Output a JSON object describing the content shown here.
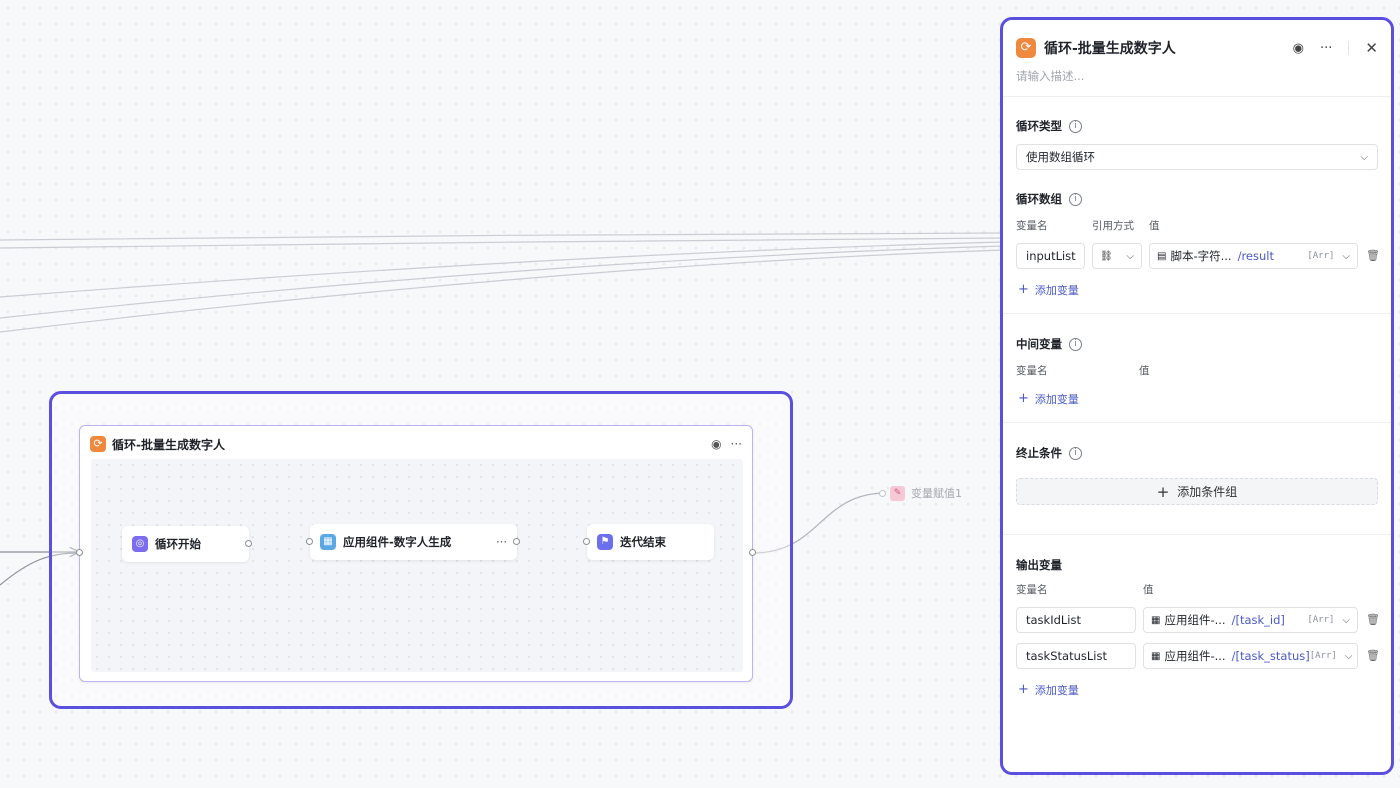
{
  "canvas": {
    "loop_node": {
      "title": "循环-批量生成数字人",
      "icon": "loop-icon",
      "more_label": "···",
      "children": {
        "start": {
          "label": "循环开始",
          "icon": "loop-start-icon"
        },
        "component": {
          "label": "应用组件-数字人生成",
          "icon": "component-icon",
          "more_label": "···"
        },
        "end": {
          "label": "迭代结束",
          "icon": "flag-icon"
        }
      }
    },
    "assign_node": {
      "label": "变量赋值1",
      "icon": "assign-icon"
    }
  },
  "panel": {
    "title": "循环-批量生成数字人",
    "description_placeholder": "请输入描述...",
    "loop_type": {
      "label": "循环类型",
      "value": "使用数组循环"
    },
    "loop_array": {
      "label": "循环数组",
      "col_var": "变量名",
      "col_ref": "引用方式",
      "col_value": "值",
      "rows": [
        {
          "name": "inputList",
          "ref_mode": "⛓",
          "source": "脚本-字符...",
          "path": "/result",
          "type_tag": "[Arr]"
        }
      ],
      "add_label": "添加变量"
    },
    "middle_vars": {
      "label": "中间变量",
      "col_var": "变量名",
      "col_value": "值",
      "add_label": "添加变量"
    },
    "stop_condition": {
      "label": "终止条件",
      "add_label": "添加条件组"
    },
    "output_vars": {
      "label": "输出变量",
      "col_var": "变量名",
      "col_value": "值",
      "rows": [
        {
          "name": "taskIdList",
          "source": "应用组件-...",
          "path": "/[task_id]",
          "type_tag": "[Arr]"
        },
        {
          "name": "taskStatusList",
          "source": "应用组件-...",
          "path": "/[task_status]",
          "type_tag": "[Arr]"
        }
      ],
      "add_label": "添加变量"
    }
  },
  "colors": {
    "accent": "#5b4fe0",
    "loop_orange": "#f0883e",
    "link": "#4a59c7"
  }
}
